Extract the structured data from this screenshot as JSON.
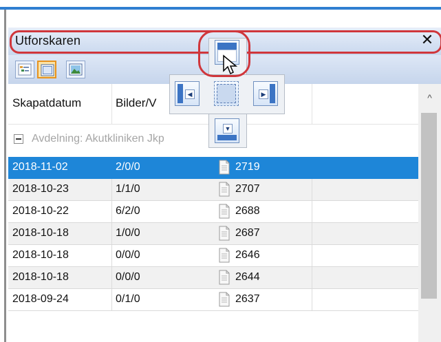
{
  "window": {
    "title": "Utforskaren",
    "close_symbol": "✕"
  },
  "toolbar": {
    "buttons": [
      {
        "icon": "tree-view-icon",
        "active": false
      },
      {
        "icon": "detail-view-icon",
        "active": true
      },
      {
        "icon": "image-view-icon",
        "active": false
      }
    ]
  },
  "table": {
    "columns": [
      "Skapatdatum",
      "Bilder/V"
    ],
    "group": {
      "toggle": "−",
      "label": "Avdelning: Akutkliniken Jkp"
    },
    "rows": [
      {
        "date": "2018-11-02",
        "images": "2/0/0",
        "id": "2719",
        "selected": true
      },
      {
        "date": "2018-10-23",
        "images": "1/1/0",
        "id": "2707",
        "selected": false
      },
      {
        "date": "2018-10-22",
        "images": "6/2/0",
        "id": "2688",
        "selected": false
      },
      {
        "date": "2018-10-18",
        "images": "1/0/0",
        "id": "2687",
        "selected": false
      },
      {
        "date": "2018-10-18",
        "images": "0/0/0",
        "id": "2646",
        "selected": false
      },
      {
        "date": "2018-10-18",
        "images": "0/0/0",
        "id": "2644",
        "selected": false
      },
      {
        "date": "2018-09-24",
        "images": "0/1/0",
        "id": "2637",
        "selected": false
      }
    ]
  },
  "scrollbar": {
    "up_arrow": "^"
  },
  "colors": {
    "selection": "#1e86d8",
    "highlight_ring": "#d0363b",
    "accent": "#2f7fd1"
  }
}
